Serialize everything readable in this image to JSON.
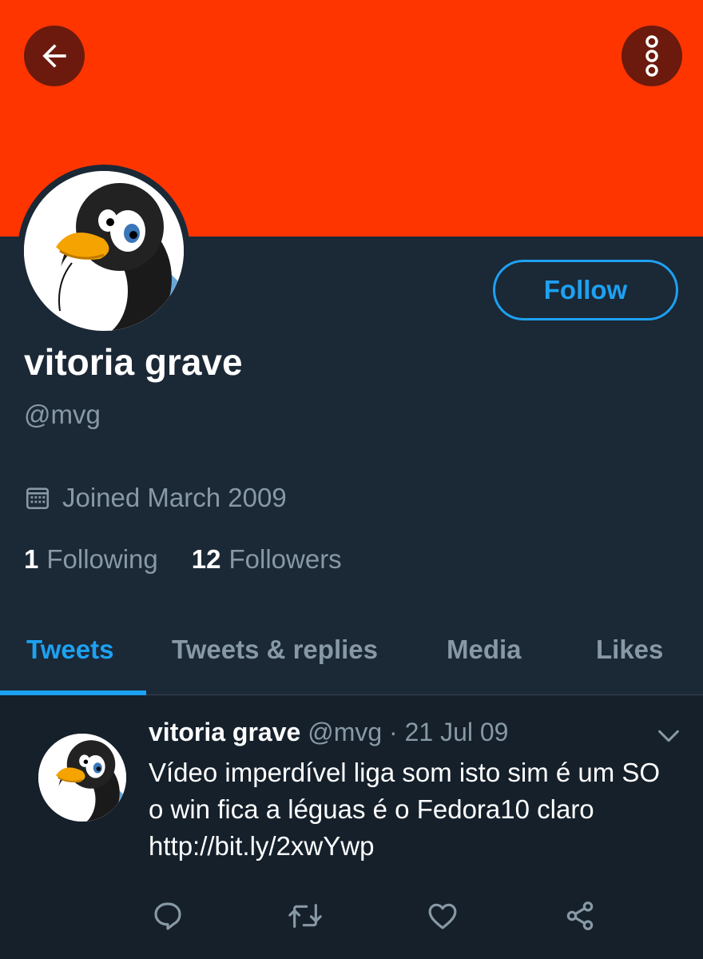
{
  "profile": {
    "display_name": "vitoria grave",
    "handle": "@mvg",
    "joined": "Joined March 2009",
    "follow_label": "Follow",
    "following_count": "1",
    "following_label": "Following",
    "followers_count": "12",
    "followers_label": "Followers"
  },
  "tabs": [
    {
      "label": "Tweets",
      "active": true
    },
    {
      "label": "Tweets & replies",
      "active": false
    },
    {
      "label": "Media",
      "active": false
    },
    {
      "label": "Likes",
      "active": false
    }
  ],
  "tweet": {
    "name": "vitoria grave",
    "meta": " @mvg · 21 Jul 09",
    "text": "Vídeo imperdível liga som isto sim é um SO o win fica a léguas é o Fedora10 claro http://bit.ly/2xwYwp"
  },
  "icons": {
    "back": "arrow-left-icon",
    "more": "more-vertical-icon",
    "calendar": "calendar-icon",
    "chevron": "chevron-down-icon",
    "reply": "reply-icon",
    "retweet": "retweet-icon",
    "like": "heart-icon",
    "share": "share-icon"
  },
  "colors": {
    "banner": "#ff3500",
    "accent": "#1da1f2",
    "background": "#15202b",
    "profile_bg": "#1b2836",
    "secondary_text": "#8899a6"
  }
}
